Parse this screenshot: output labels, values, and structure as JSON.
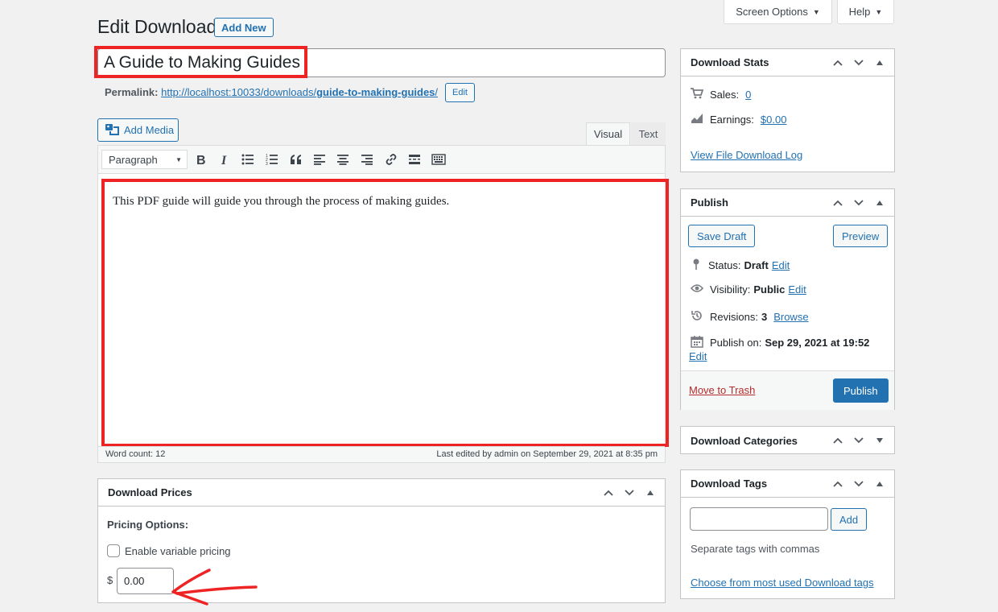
{
  "header": {
    "screen_options_label": "Screen Options",
    "help_label": "Help",
    "page_title": "Edit Download",
    "add_new_label": "Add New"
  },
  "post": {
    "title": "A Guide to Making Guides",
    "permalink_label": "Permalink:",
    "permalink_base": "http://localhost:10033/downloads/",
    "permalink_slug": "guide-to-making-guides",
    "permalink_trail": "/",
    "permalink_edit_label": "Edit"
  },
  "editor": {
    "add_media_label": "Add Media",
    "tabs": [
      {
        "label": "Visual",
        "active": true
      },
      {
        "label": "Text",
        "active": false
      }
    ],
    "format_select": "Paragraph",
    "toolbar_icons": [
      "bold-icon",
      "italic-icon",
      "bulleted-list-icon",
      "numbered-list-icon",
      "blockquote-icon",
      "align-left-icon",
      "align-center-icon",
      "align-right-icon",
      "link-icon",
      "read-more-icon",
      "toolbar-toggle-icon"
    ],
    "content": "This PDF guide will guide you through the process of making guides.",
    "word_count": "Word count: 12",
    "last_edited": "Last edited by admin on September 29, 2021 at 8:35 pm"
  },
  "download_prices": {
    "title": "Download Prices",
    "pricing_options_label": "Pricing Options:",
    "variable_pricing_label": "Enable variable pricing",
    "variable_pricing_checked": false,
    "currency_symbol": "$",
    "price_value": "0.00"
  },
  "download_stats": {
    "title": "Download Stats",
    "sales_label": "Sales:",
    "sales_value": "0",
    "earnings_label": "Earnings:",
    "earnings_value": "$0.00",
    "log_link": "View File Download Log"
  },
  "publish": {
    "title": "Publish",
    "save_draft_label": "Save Draft",
    "preview_label": "Preview",
    "status_label": "Status:",
    "status_value": "Draft",
    "visibility_label": "Visibility:",
    "visibility_value": "Public",
    "revisions_label": "Revisions:",
    "revisions_value": "3",
    "browse_label": "Browse",
    "publish_on_label": "Publish on:",
    "publish_on_value": "Sep 29, 2021 at 19:52",
    "edit_label": "Edit",
    "trash_label": "Move to Trash",
    "publish_label": "Publish"
  },
  "download_categories": {
    "title": "Download Categories"
  },
  "download_tags": {
    "title": "Download Tags",
    "input_value": "",
    "add_label": "Add",
    "hint": "Separate tags with commas",
    "most_used_link": "Choose from most used Download tags"
  },
  "colors": {
    "accent": "#2271b1",
    "highlight_red": "#ee2424",
    "trash_red": "#b32d2e"
  }
}
